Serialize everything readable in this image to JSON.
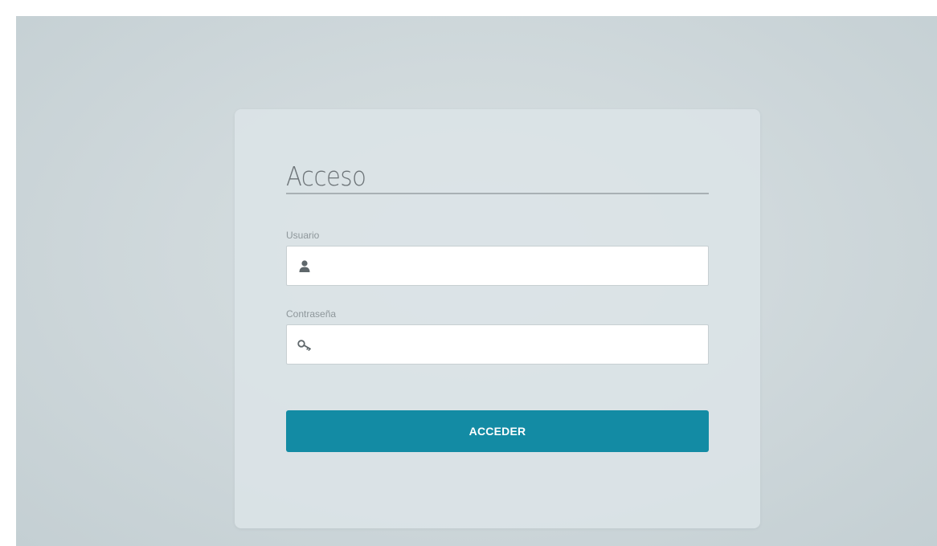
{
  "login": {
    "title": "Acceso",
    "username": {
      "label": "Usuario",
      "value": "",
      "icon": "user-icon"
    },
    "password": {
      "label": "Contraseña",
      "value": "",
      "icon": "key-icon"
    },
    "submit_label": "ACCEDER"
  },
  "colors": {
    "accent": "#138ba4",
    "card_background": "#dce4e7",
    "page_background": "#d0d9dc",
    "title_text": "#6d7478",
    "label_text": "#8e979b"
  }
}
